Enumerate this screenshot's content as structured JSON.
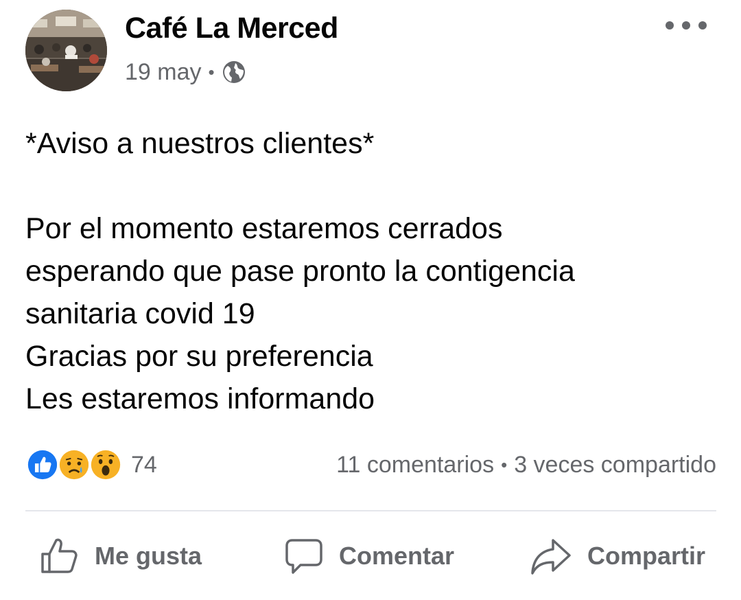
{
  "post": {
    "page_name": "Café La Merced",
    "date": "19 may",
    "separator": "•",
    "privacy_icon": "globe-icon",
    "more_icon": "more-options-icon",
    "text": "*Aviso a nuestros clientes*\n\nPor el momento estaremos cerrados\nesperando que pase pronto la contigencia\nsanitaria covid 19\nGracias por su preferencia\nLes estaremos informando"
  },
  "engagement": {
    "reaction_icons": [
      "like-reaction-icon",
      "sad-reaction-icon",
      "wow-reaction-icon"
    ],
    "reaction_count": "74",
    "comments": "11 comentarios",
    "separator": "•",
    "shares": "3 veces compartido"
  },
  "actions": {
    "like": {
      "label": "Me gusta",
      "icon": "thumbs-up-icon"
    },
    "comment": {
      "label": "Comentar",
      "icon": "speech-bubble-icon"
    },
    "share": {
      "label": "Compartir",
      "icon": "share-arrow-icon"
    }
  },
  "colors": {
    "text_primary": "#050505",
    "text_secondary": "#65676b",
    "like_blue": "#1877f2",
    "reaction_yellow": "#f7b125",
    "divider": "#e4e6eb"
  }
}
